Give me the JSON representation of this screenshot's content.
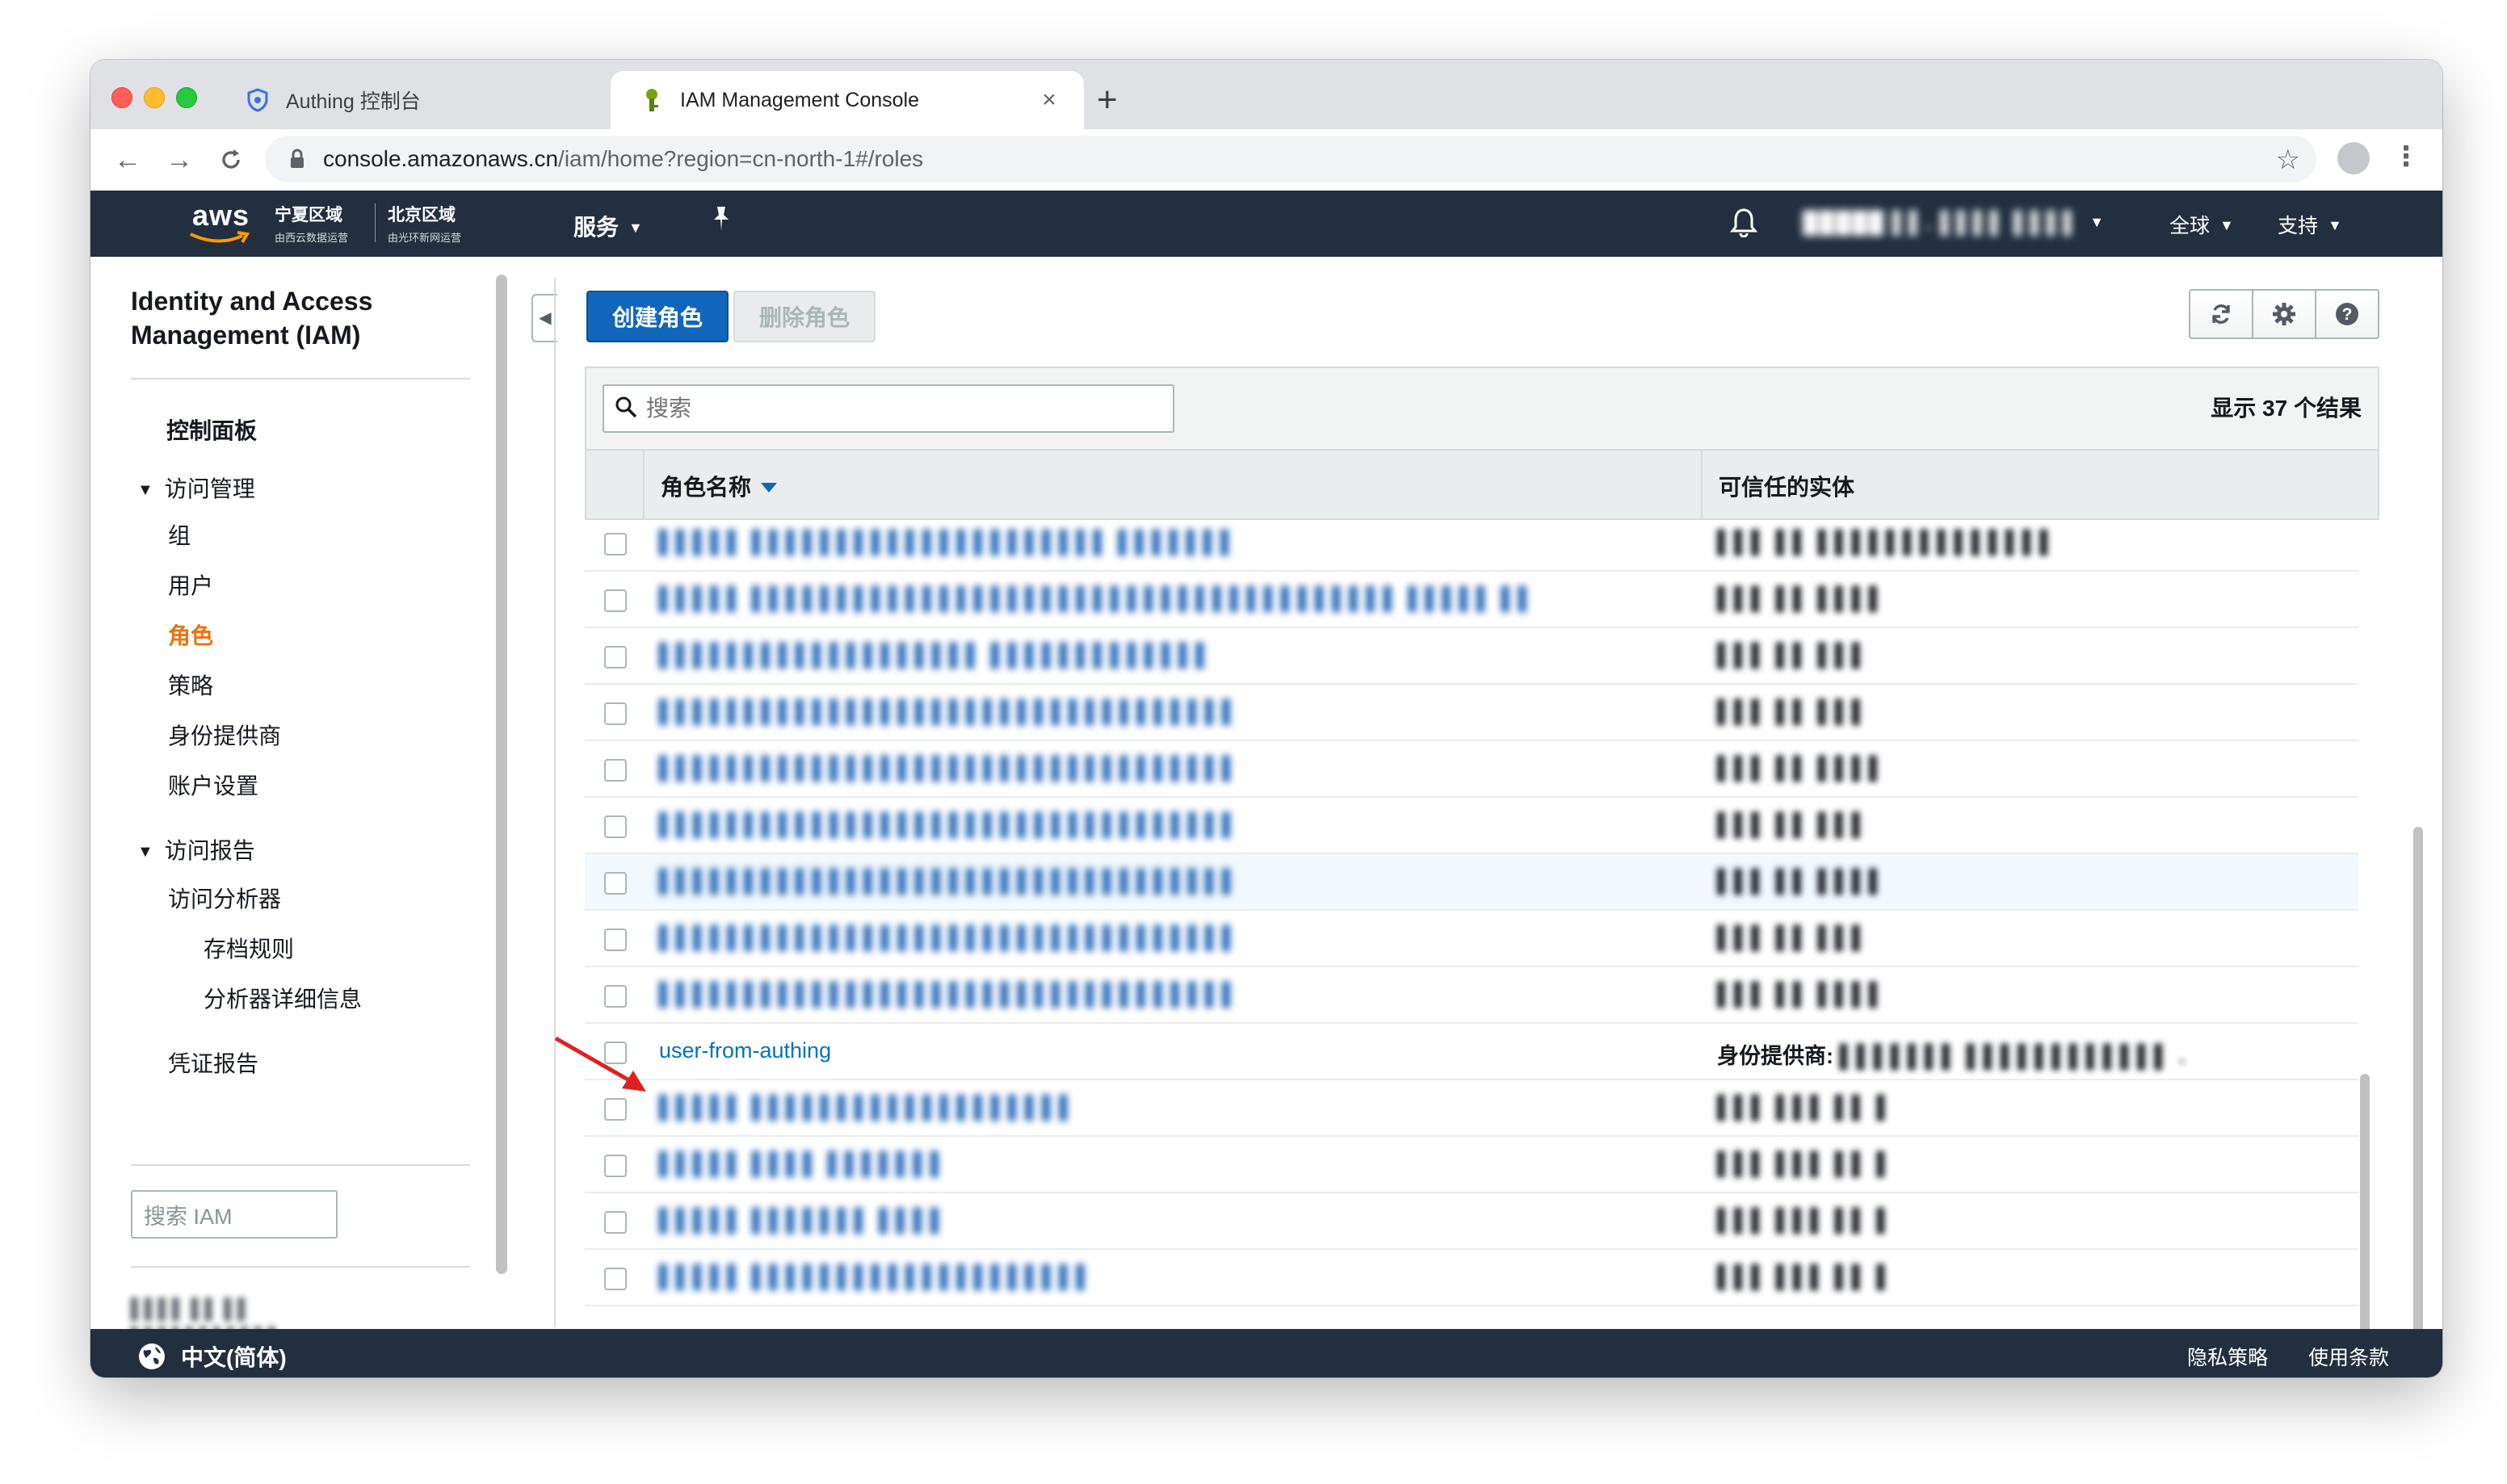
{
  "browser": {
    "tabs": [
      {
        "title": "Authing 控制台",
        "icon": "shield-icon"
      },
      {
        "title": "IAM Management Console",
        "icon": "aws-key-icon"
      }
    ],
    "url": {
      "host": "console.amazonaws.cn",
      "path": "/iam/home?region=cn-north-1#/roles"
    }
  },
  "aws_header": {
    "logo": "aws",
    "region1": {
      "name": "宁夏区域",
      "sub": "由西云数据运营"
    },
    "region2": {
      "name": "北京区域",
      "sub": "由光环新网运营"
    },
    "services": "服务",
    "account": "█████ ▌▌. ▌▌▌▌ ▌▌▌▌",
    "global": "全球",
    "support": "支持"
  },
  "sidebar": {
    "title": "Identity and Access Management (IAM)",
    "dashboard": "控制面板",
    "access_mgmt": "访问管理",
    "items": [
      "组",
      "用户",
      "角色",
      "策略",
      "身份提供商",
      "账户设置"
    ],
    "access_reports": "访问报告",
    "report_items": [
      "访问分析器",
      "存档规则",
      "分析器详细信息",
      "凭证报告"
    ],
    "search_placeholder": "搜索 IAM",
    "account_blur": [
      "▌▌▌▌ ▌▌ ▌▌",
      "▌▌▌▌▌▌▌▌▌▌▌"
    ]
  },
  "main": {
    "create_role": "创建角色",
    "delete_role": "删除角色",
    "search_placeholder": "搜索",
    "result_count": "显示 37 个结果",
    "col_role_name": "角色名称",
    "col_trusted": "可信任的实体",
    "rows": [
      {
        "name": "▌▌▌▌▌ ▌▌▌▌▌▌▌▌▌▌▌▌▌▌▌▌▌▌▌▌▌ ▌▌▌▌▌▌▌",
        "trusted": "▌▌▌ ▌▌ ▌▌▌▌▌▌▌▌▌▌▌▌▌▌"
      },
      {
        "name": "▌▌▌▌▌ ▌▌▌▌▌▌▌▌▌▌▌▌▌▌▌▌▌▌▌▌▌▌▌▌▌▌▌▌▌▌▌▌▌▌▌▌▌▌ ▌▌▌▌▌ ▌▌",
        "trusted": "▌▌▌ ▌▌ ▌▌▌▌"
      },
      {
        "name": "▌▌▌▌▌▌▌▌▌▌▌▌▌▌▌▌▌▌▌ ▌▌▌▌▌▌▌▌▌▌▌▌▌",
        "trusted": "▌▌▌ ▌▌ ▌▌▌"
      },
      {
        "name": "▌▌▌▌▌▌▌▌▌▌▌▌▌▌▌▌▌▌▌▌▌▌▌▌▌▌▌▌▌▌▌▌▌▌",
        "trusted": "▌▌▌ ▌▌ ▌▌▌"
      },
      {
        "name": "▌▌▌▌▌▌▌▌▌▌▌▌▌▌▌▌▌▌▌▌▌▌▌▌▌▌▌▌▌▌▌▌▌▌",
        "trusted": "▌▌▌ ▌▌ ▌▌▌▌"
      },
      {
        "name": "▌▌▌▌▌▌▌▌▌▌▌▌▌▌▌▌▌▌▌▌▌▌▌▌▌▌▌▌▌▌▌▌▌▌",
        "trusted": "▌▌▌ ▌▌ ▌▌▌"
      },
      {
        "name": "▌▌▌▌▌▌▌▌▌▌▌▌▌▌▌▌▌▌▌▌▌▌▌▌▌▌▌▌▌▌▌▌▌▌",
        "trusted": "▌▌▌ ▌▌ ▌▌▌▌"
      },
      {
        "name": "▌▌▌▌▌▌▌▌▌▌▌▌▌▌▌▌▌▌▌▌▌▌▌▌▌▌▌▌▌▌▌▌▌▌",
        "trusted": "▌▌▌ ▌▌ ▌▌▌"
      },
      {
        "name": "▌▌▌▌▌▌▌▌▌▌▌▌▌▌▌▌▌▌▌▌▌▌▌▌▌▌▌▌▌▌▌▌▌▌",
        "trusted": "▌▌▌ ▌▌ ▌▌▌▌"
      },
      {
        "name": "user-from-authing",
        "trusted_label": "身份提供商:",
        "trusted": "▌▌▌▌▌▌▌ ▌▌▌▌▌▌▌▌▌▌▌▌ ."
      },
      {
        "name": "▌▌▌▌▌ ▌▌▌▌▌▌▌▌▌▌▌▌▌▌▌▌▌▌▌",
        "trusted": "▌▌▌ ▌▌▌ ▌▌ ▌"
      },
      {
        "name": "▌▌▌▌▌ ▌▌▌▌ ▌▌▌▌▌▌▌",
        "trusted": "▌▌▌ ▌▌▌ ▌▌ ▌"
      },
      {
        "name": "▌▌▌▌▌ ▌▌▌▌▌▌▌ ▌▌▌▌",
        "trusted": "▌▌▌ ▌▌▌ ▌▌ ▌"
      },
      {
        "name": "▌▌▌▌▌ ▌▌▌▌▌▌▌▌▌▌▌▌▌▌▌▌▌▌▌▌",
        "trusted": "▌▌▌ ▌▌▌ ▌▌ ▌"
      }
    ]
  },
  "footer": {
    "language": "中文(简体)",
    "privacy": "隐私策略",
    "terms": "使用条款"
  },
  "colors": {
    "aws_nav": "#232f3e",
    "primary_button": "#1166bb",
    "active_nav": "#ec7211",
    "link": "#0073bb",
    "annotation_arrow": "#e02020"
  }
}
